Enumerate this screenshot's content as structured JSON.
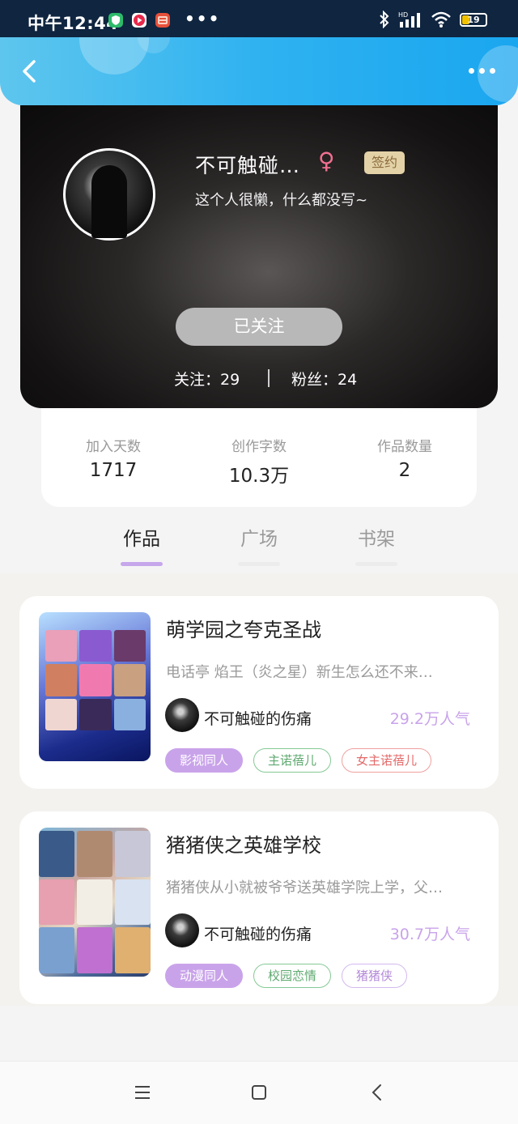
{
  "status_bar": {
    "time": "中午12:44",
    "notification_dots": "•••",
    "battery_level": "19",
    "app_icons": [
      "shield-app-icon",
      "video-app-icon",
      "taobao-app-icon"
    ],
    "signal_icons": [
      "bluetooth-icon",
      "hd-signal-icon",
      "wifi-icon"
    ]
  },
  "header": {
    "back_icon": "chevron-left-icon",
    "more_icon": "more-dots-icon"
  },
  "profile": {
    "name": "不可触碰…",
    "gender_symbol": "♀",
    "signed_badge": "签约",
    "bio": "这个人很懒，什么都没写~",
    "follow_button": "已关注",
    "following": "关注：29",
    "followers": "粉丝：24"
  },
  "stats": [
    {
      "label": "加入天数",
      "value": "1717"
    },
    {
      "label": "创作字数",
      "value": "10.3万"
    },
    {
      "label": "作品数量",
      "value": "2"
    }
  ],
  "tabs": [
    {
      "label": "作品",
      "active": true
    },
    {
      "label": "广场",
      "active": false
    },
    {
      "label": "书架",
      "active": false
    }
  ],
  "works": [
    {
      "title": "萌学园之夸克圣战",
      "description": "电话亭 焰王（炎之星）新生怎么还不来…",
      "author": "不可触碰的伤痛",
      "popularity": "29.2万人气",
      "tags": [
        "影视同人",
        "主诺蓓儿",
        "女主诺蓓儿"
      ]
    },
    {
      "title": "猪猪侠之英雄学校",
      "description": "猪猪侠从小就被爷爷送英雄学院上学，父…",
      "author": "不可触碰的伤痛",
      "popularity": "30.7万人气",
      "tags": [
        "动漫同人",
        "校园恋情",
        "猪猪侠"
      ]
    }
  ],
  "nav_bar": {
    "icons": [
      "menu-icon",
      "home-square-icon",
      "back-triangle-icon"
    ]
  },
  "colors": {
    "header_gradient": [
      "#5ec6ee",
      "#1aa6ef"
    ],
    "accent_purple": "#c9a3ea",
    "tag_green": "#5fa970",
    "tag_red": "#e36a6a"
  }
}
